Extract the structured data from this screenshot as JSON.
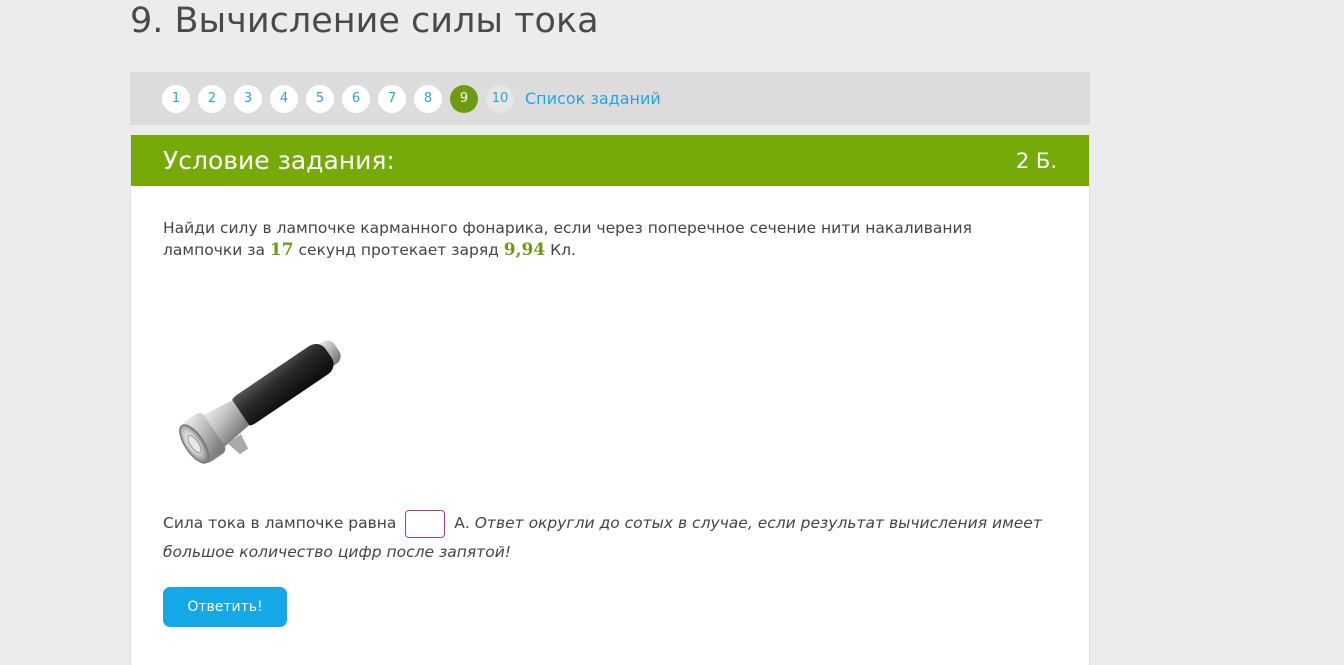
{
  "page": {
    "title": "9. Вычисление силы тока"
  },
  "pager": {
    "items": [
      "1",
      "2",
      "3",
      "4",
      "5",
      "6",
      "7",
      "8",
      "9",
      "10"
    ],
    "active": "9",
    "task_list_label": "Список заданий"
  },
  "card": {
    "title": "Условие задания:",
    "points": "2 Б."
  },
  "question": {
    "part1": "Найди силу в лампочке карманного фонарика, если через поперечное сечение нити накаливания лампочки за ",
    "time_value": "17",
    "part2": " секунд протекает заряд ",
    "charge_value": "9,94",
    "part3": " Кл."
  },
  "image": {
    "icon": "flashlight-icon"
  },
  "answer": {
    "prefix": "Сила тока в лампочке равна ",
    "input_value": "",
    "unit": " А. ",
    "hint": "Ответ округли до сотых в случае, если результат вычисления имеет большое количество цифр после запятой!"
  },
  "submit": {
    "label": "Ответить!"
  },
  "colors": {
    "header_green": "#76aa09",
    "active_page": "#6f9b14",
    "link_blue": "#2aa2dc",
    "button_blue": "#14a9e6",
    "input_border": "#b03a86"
  }
}
